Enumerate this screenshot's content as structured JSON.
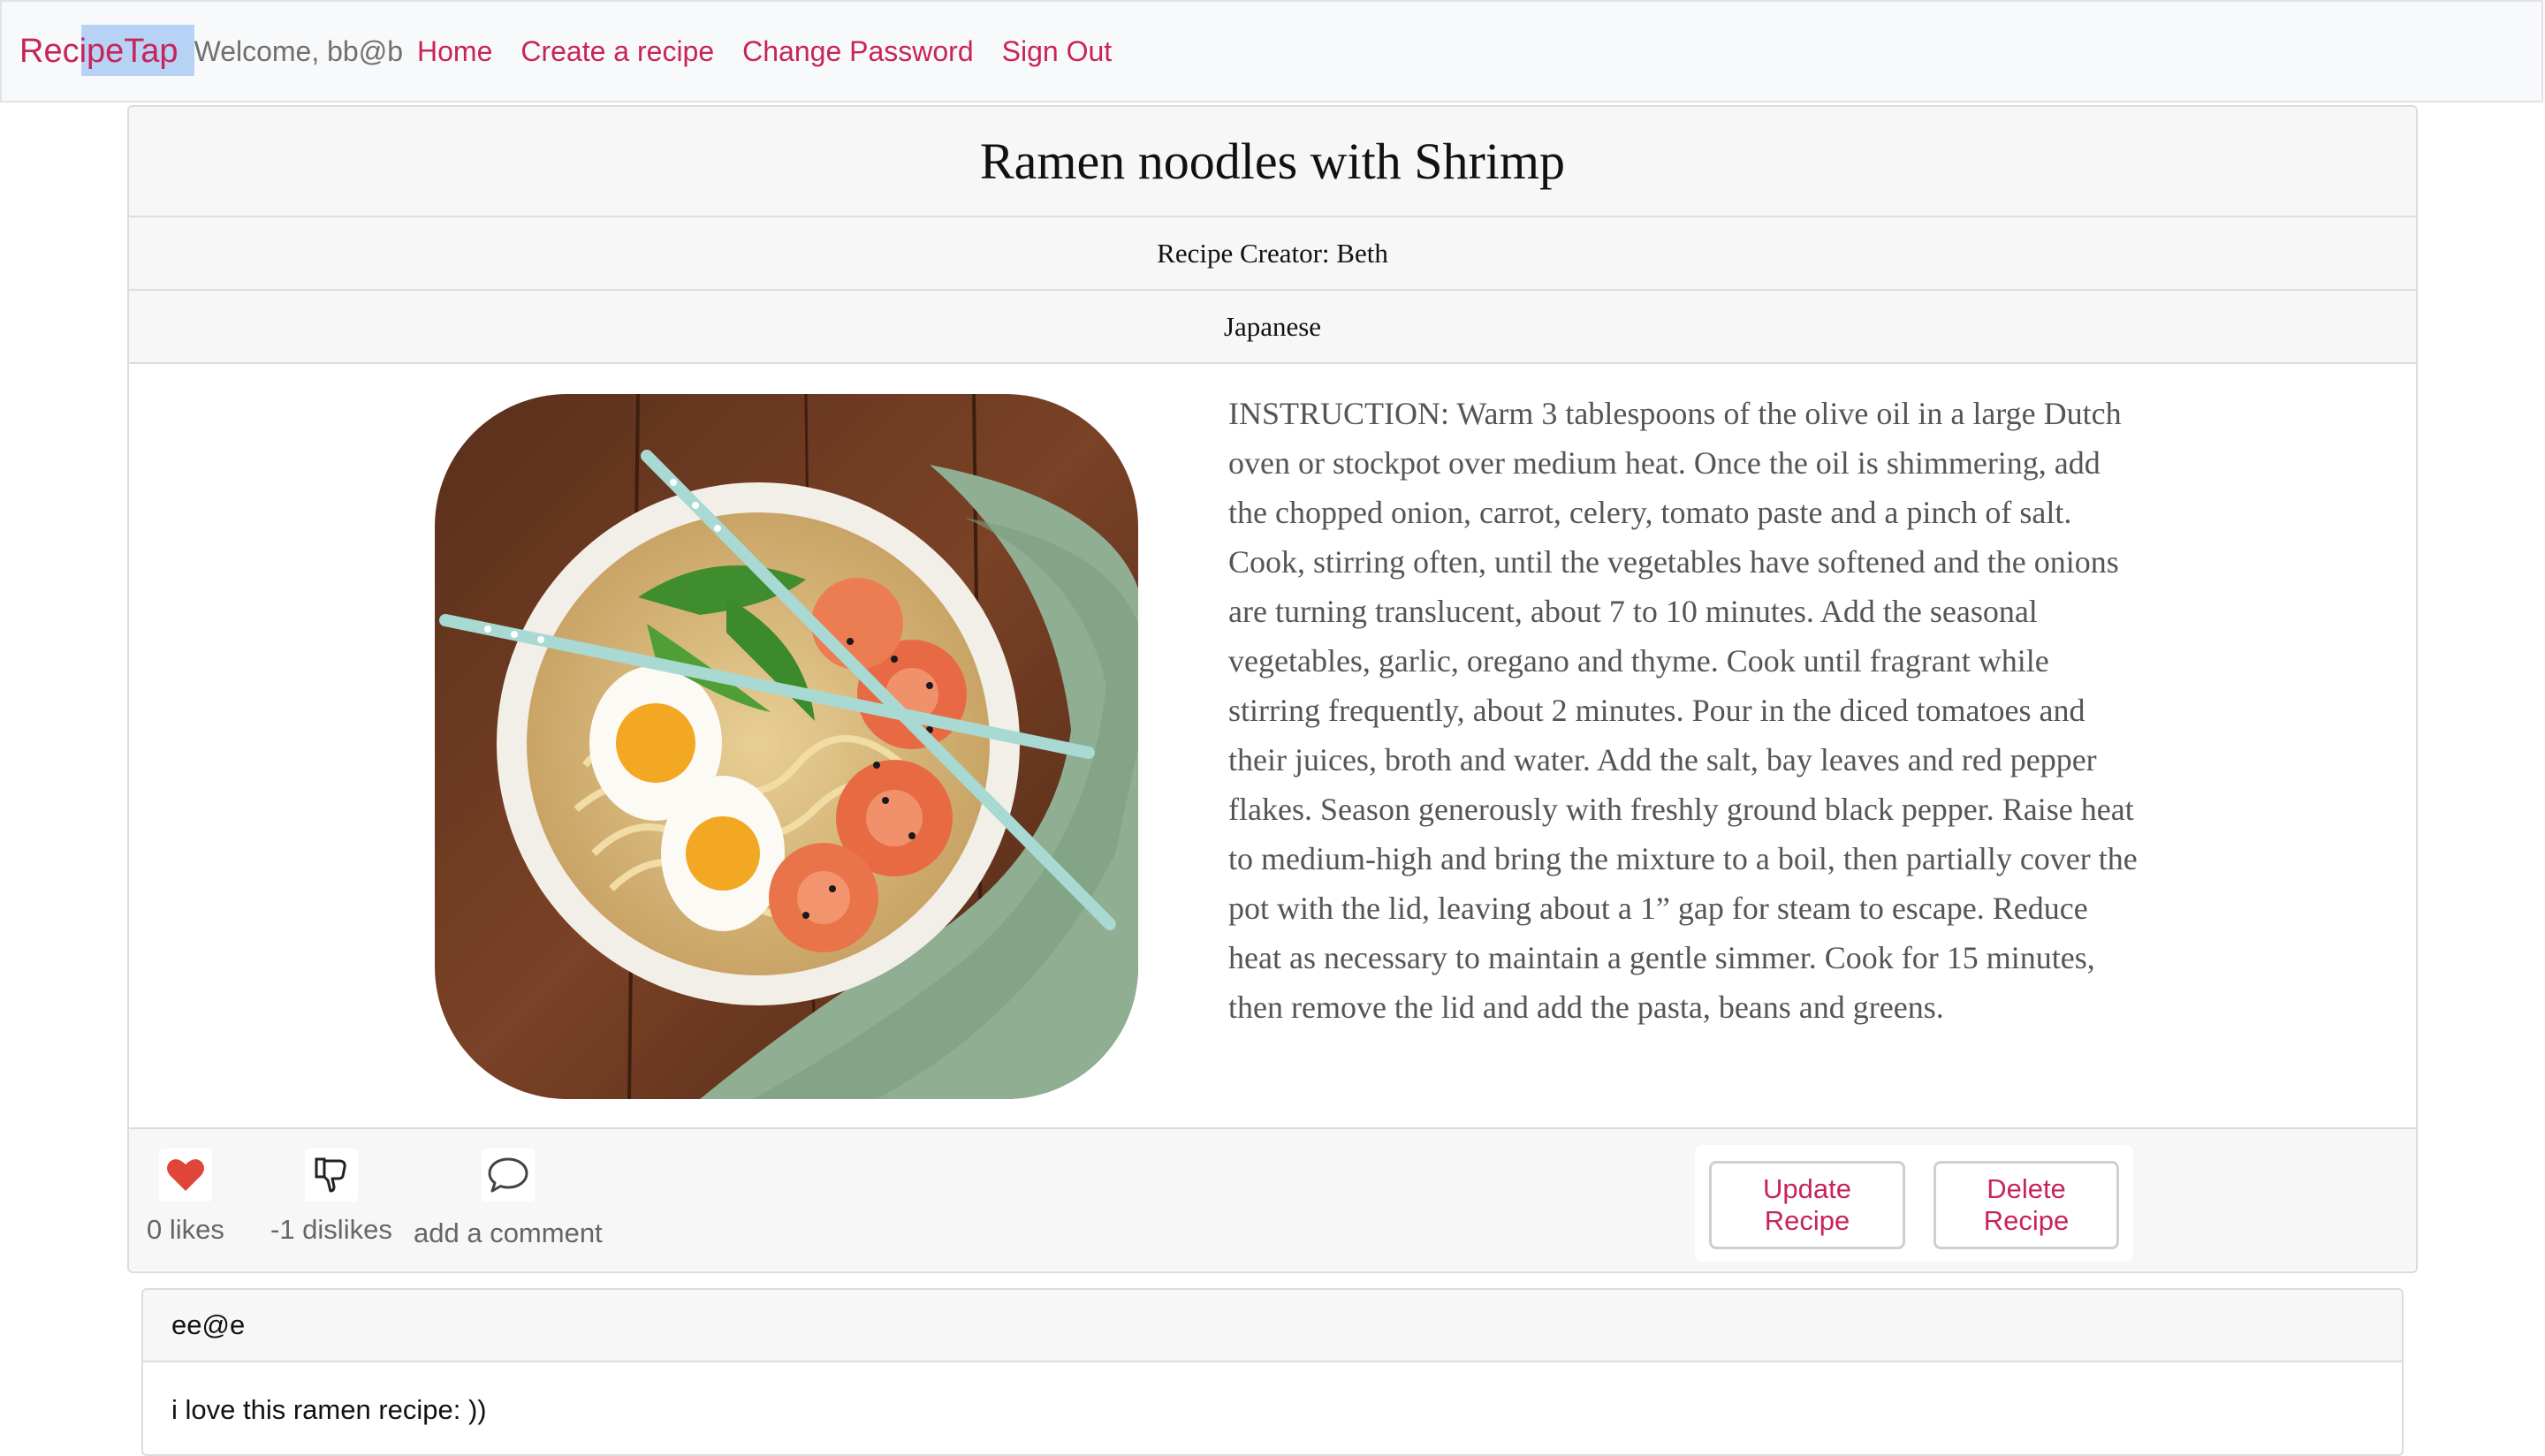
{
  "navbar": {
    "brand": "RecipeTap",
    "welcome": "Welcome, bb@b",
    "links": [
      "Home",
      "Create a recipe",
      "Change Password",
      "Sign Out"
    ]
  },
  "recipe": {
    "title": "Ramen noodles with Shrimp",
    "creator": "Recipe Creator: Beth",
    "cuisine": "Japanese",
    "instructions": "INSTRUCTION: Warm 3 tablespoons of the olive oil in a large Dutch oven or stockpot over medium heat. Once the oil is shimmering, add the chopped onion, carrot, celery, tomato paste and a pinch of salt. Cook, stirring often, until the vegetables have softened and the onions are turning translucent, about 7 to 10 minutes. Add the seasonal vegetables, garlic, oregano and thyme. Cook until fragrant while stirring frequently, about 2 minutes. Pour in the diced tomatoes and their juices, broth and water. Add the salt, bay leaves and red pepper flakes. Season generously with freshly ground black pepper. Raise heat to medium-high and bring the mixture to a boil, then partially cover the pot with the lid, leaving about a 1” gap for steam to escape. Reduce heat as necessary to maintain a gentle simmer. Cook for 15 minutes, then remove the lid and add the pasta, beans and greens."
  },
  "footer": {
    "likes_label": "0 likes",
    "dislikes_label": "-1 dislikes",
    "comment_label": "add a comment",
    "update_button": "Update Recipe",
    "delete_button": "Delete Recipe"
  },
  "comments": [
    {
      "author": "ee@e",
      "text": "i love this ramen recipe: ))"
    }
  ],
  "colors": {
    "accent": "#c8245a",
    "heart": "#e0453a"
  },
  "icons": [
    "heart-icon",
    "thumbs-down-icon",
    "speech-bubble-icon"
  ]
}
